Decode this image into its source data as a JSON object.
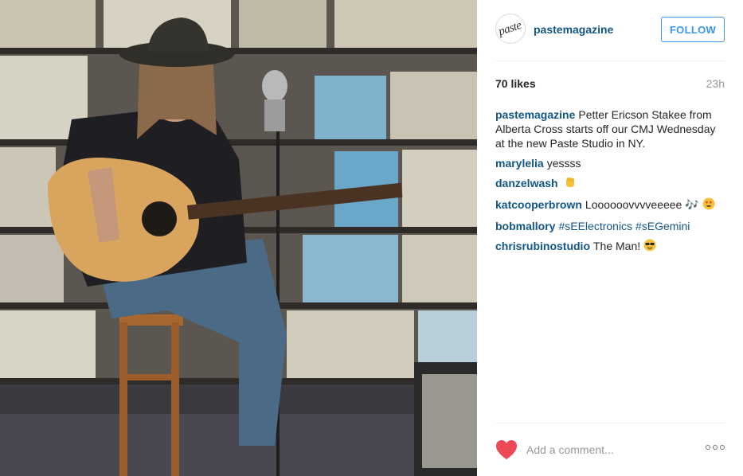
{
  "post": {
    "author": "pastemagazine",
    "avatar_text": "paste",
    "follow_label": "FOLLOW",
    "likes": "70 likes",
    "time_ago": "23h",
    "caption": {
      "user": "pastemagazine",
      "text": "Petter Ericson Stakee from Alberta Cross starts off our CMJ Wednesday at the new Paste Studio in NY."
    },
    "comments": [
      {
        "user": "marylelia",
        "text": "yessss"
      },
      {
        "user": "danzelwash",
        "text": "",
        "emoji": "fist-emoji"
      },
      {
        "user": "katcooperbrown",
        "text": "Loooooovvvveeeee 🎶",
        "emoji": "heart-eyes-emoji"
      },
      {
        "user": "bobmallory",
        "tags": [
          "#sEElectronics",
          "#sEGemini"
        ]
      },
      {
        "user": "chrisrubinostudio",
        "text": "The Man!",
        "emoji": "sunglasses-emoji"
      }
    ],
    "add_comment_placeholder": "Add a comment...",
    "heart_color": "#ed4956",
    "link_color": "#125688",
    "follow_color": "#3897f0"
  }
}
